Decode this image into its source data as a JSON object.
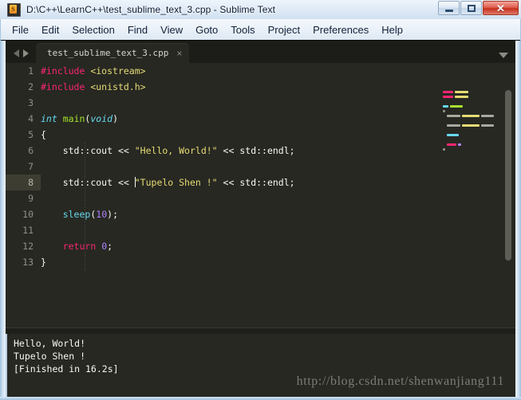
{
  "window": {
    "title": "D:\\C++\\LearnC++\\test_sublime_text_3.cpp - Sublime Text",
    "app_icon": "sublime-text-icon",
    "icon_letter": "S",
    "buttons": {
      "minimize": "minimize-icon",
      "maximize": "maximize-icon",
      "close": "✕"
    }
  },
  "menubar": {
    "items": [
      "File",
      "Edit",
      "Selection",
      "Find",
      "View",
      "Goto",
      "Tools",
      "Project",
      "Preferences",
      "Help"
    ]
  },
  "tabbar": {
    "prev_icon": "arrow-left-icon",
    "next_icon": "arrow-right-icon",
    "menu_icon": "chevron-down-icon",
    "tabs": [
      {
        "label": "test_sublime_text_3.cpp",
        "close": "×",
        "active": true
      }
    ]
  },
  "editor": {
    "active_line": 8,
    "cursor": {
      "line": 8,
      "column": 17
    },
    "line_numbers": [
      1,
      2,
      3,
      4,
      5,
      6,
      7,
      8,
      9,
      10,
      11,
      12,
      13
    ],
    "lines": [
      {
        "n": 1,
        "text": "#include <iostream>"
      },
      {
        "n": 2,
        "text": "#include <unistd.h>"
      },
      {
        "n": 3,
        "text": ""
      },
      {
        "n": 4,
        "text": "int main(void)"
      },
      {
        "n": 5,
        "text": "{"
      },
      {
        "n": 6,
        "text": "    std::cout << \"Hello, World!\" << std::endl;"
      },
      {
        "n": 7,
        "text": ""
      },
      {
        "n": 8,
        "text": "    std::cout << \"Tupelo Shen !\" << std::endl;"
      },
      {
        "n": 9,
        "text": ""
      },
      {
        "n": 10,
        "text": "    sleep(10);"
      },
      {
        "n": 11,
        "text": ""
      },
      {
        "n": 12,
        "text": "    return 0;"
      },
      {
        "n": 13,
        "text": "}"
      }
    ],
    "tokens": {
      "preprocessor": "#include",
      "header1": "<iostream>",
      "header2": "<unistd.h>",
      "kw_int": "int",
      "fn_main": "main",
      "kw_void": "void",
      "str_hello": "\"Hello, World!\"",
      "str_tupelo": "\"Tupelo Shen !\"",
      "fn_sleep": "sleep",
      "num_10": "10",
      "kw_return": "return",
      "num_0": "0",
      "std_cout": "std::cout",
      "std_endl": "std::endl",
      "shift_op": "<<",
      "brace_open": "{",
      "brace_close": "}",
      "semicolon": ";",
      "paren_open": "(",
      "paren_close": ")"
    },
    "colors": {
      "background": "#272822",
      "foreground": "#f8f8f2",
      "gutter_text": "#8f908a",
      "active_line": "#3e3d32",
      "pink": "#f92672",
      "yellow": "#e6db74",
      "cyan": "#66d9ef",
      "green": "#a6e22e",
      "purple": "#ae81ff"
    }
  },
  "output_panel": {
    "lines": [
      "Hello, World!",
      "Tupelo Shen !",
      "[Finished in 16.2s]"
    ]
  },
  "watermark": {
    "text": "http://blog.csdn.net/shenwanjiang111"
  }
}
